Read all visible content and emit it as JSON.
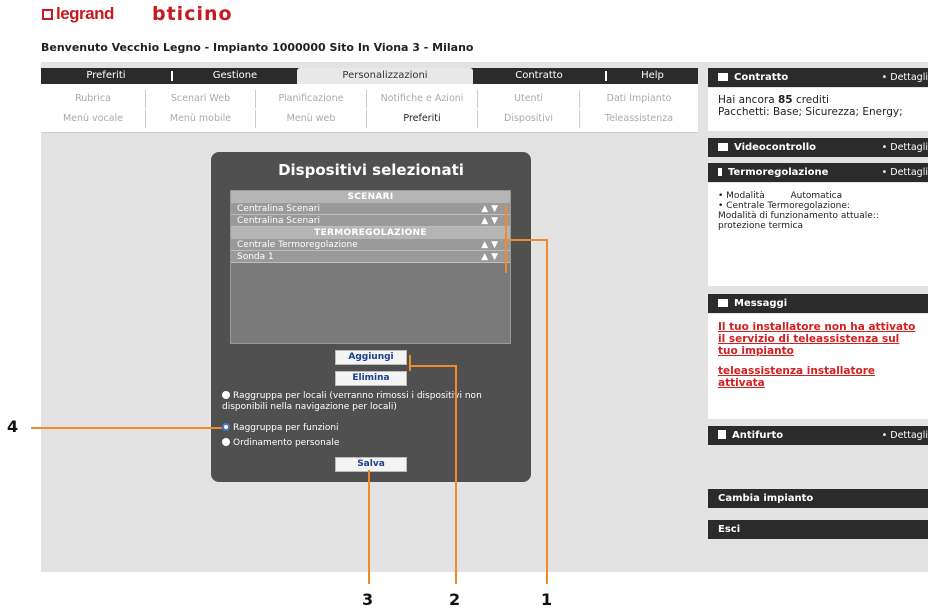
{
  "header": {
    "brand_legrand": "legrand",
    "brand_bticino": "bticino",
    "welcome": "Benvenuto Vecchio Legno - Impianto 1000000 Sito In Viona 3 - Milano"
  },
  "tabs": [
    "Preferiti",
    "Gestione",
    "Personalizzazioni",
    "Contratto",
    "Help"
  ],
  "submenu": {
    "row1": [
      "Rubrica",
      "Scenari Web",
      "Pianificazione",
      "Notifiche e Azioni",
      "Utenti",
      "Dati Impianto"
    ],
    "row2": [
      "Menù vocale",
      "Menù mobile",
      "Menù web",
      "Preferiti",
      "Dispositivi",
      "Teleassistenza"
    ]
  },
  "dialog": {
    "title": "Dispositivi selezionati",
    "list": {
      "header_scenari": "SCENARI",
      "item1": "Centralina Scenari",
      "item2": "Centralina Scenari",
      "header_termo": "TERMOREGOLAZIONE",
      "item3": "Centrale Termoregolazione",
      "item4": "Sonda 1",
      "arrows": "▲ ▼"
    },
    "btn_add": "Aggiungi",
    "btn_remove": "Elimina",
    "radio1": "Raggruppa per locali (verranno rimossi i dispositivi non disponibili nella navigazione per locali)",
    "radio2": "Raggruppa per funzioni",
    "radio3": "Ordinamento personale",
    "btn_save": "Salva"
  },
  "right_panel": {
    "contratto": {
      "title": "Contratto",
      "link": "• Dettagli",
      "line1_pre": "Hai ancora",
      "credits": "85",
      "line1_post": "crediti",
      "line2": "Pacchetti: Base; Sicurezza; Energy;"
    },
    "video": {
      "title": "Videocontrollo",
      "link": "• Dettagli"
    },
    "termo": {
      "title": "Termoregolazione",
      "link": "• Dettagli",
      "l1a": "• Modalità",
      "l1b": "Automatica",
      "l2": "• Centrale Termoregolazione:",
      "l3": "Modalità di funzionamento attuale::",
      "l4": "protezione termica"
    },
    "messaggi": {
      "title": "Messaggi",
      "msg1": "Il tuo installatore non ha attivato il servizio di teleassistenza sul tuo impianto",
      "msg2": "teleassistenza installatore attivata"
    },
    "antifurto": {
      "title": "Antifurto",
      "link": "• Dettagli"
    },
    "cambia": "Cambia impianto",
    "esci": "Esci"
  },
  "callouts": [
    "1",
    "2",
    "3",
    "4"
  ],
  "colors": {
    "accent_orange": "#f28a2a",
    "brand_red": "#c8191f",
    "dark_bar": "#2b2b2b"
  }
}
